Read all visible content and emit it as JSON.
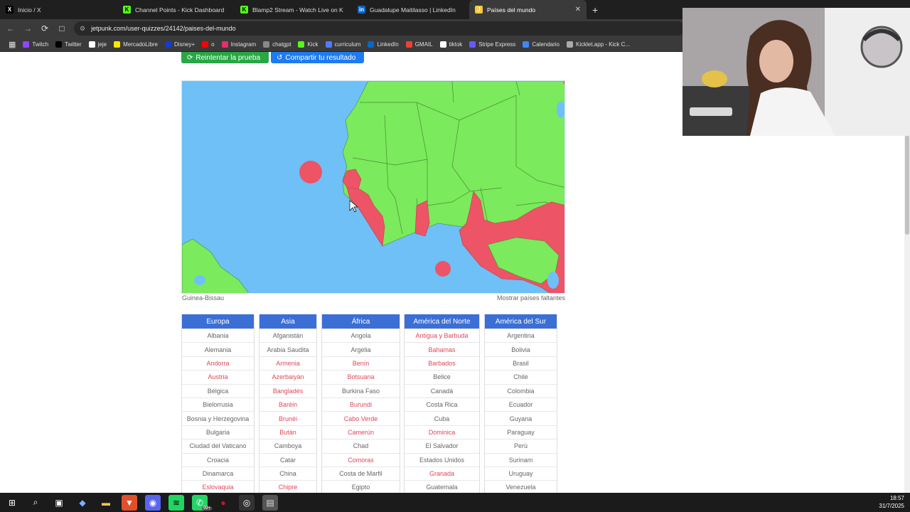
{
  "browser": {
    "tabs": [
      {
        "title": "Inicio / X",
        "icon": "x-icon",
        "active": false
      },
      {
        "title": "Channel Points - Kick Dashboard",
        "icon": "kick-icon",
        "active": false
      },
      {
        "title": "Blamp2 Stream - Watch Live on K",
        "icon": "kick-icon",
        "active": false
      },
      {
        "title": "Guadalupe Maitilasso | LinkedIn",
        "icon": "linkedin-icon",
        "active": false
      },
      {
        "title": "Países del mundo",
        "icon": "jetpunk-icon",
        "active": true
      }
    ],
    "new_tab": "+",
    "close_tab": "✕",
    "url": "jetpunk.com/user-quizzes/24142/paises-del-mundo",
    "bookmarks": [
      {
        "label": "Twitch",
        "icon": "twitch-icon",
        "color": "#9146ff"
      },
      {
        "label": "Twitter",
        "icon": "x-icon",
        "color": "#000000"
      },
      {
        "label": "jeje",
        "icon": "github-icon",
        "color": "#ffffff"
      },
      {
        "label": "MercadoLibre",
        "icon": "mercadolibre-icon",
        "color": "#ffe600"
      },
      {
        "label": "Disney+",
        "icon": "disney-icon",
        "color": "#113ccf"
      },
      {
        "label": "o",
        "icon": "youtube-icon",
        "color": "#ff0000"
      },
      {
        "label": "Instagram",
        "icon": "instagram-icon",
        "color": "#e1306c"
      },
      {
        "label": "chatgpt",
        "icon": "chatgpt-icon",
        "color": "#888888"
      },
      {
        "label": "Kick",
        "icon": "kick-icon",
        "color": "#53fc18"
      },
      {
        "label": "curriculum",
        "icon": "docs-icon",
        "color": "#4f7bff"
      },
      {
        "label": "LinkedIn",
        "icon": "linkedin-icon",
        "color": "#0a66c2"
      },
      {
        "label": "GMAIL",
        "icon": "gmail-icon",
        "color": "#ea4335"
      },
      {
        "label": "tiktok",
        "icon": "tiktok-icon",
        "color": "#ffffff"
      },
      {
        "label": "Stripe Express",
        "icon": "stripe-icon",
        "color": "#635bff"
      },
      {
        "label": "Calendario",
        "icon": "calendar-icon",
        "color": "#4285f4"
      },
      {
        "label": "Kicklet.app - Kick C...",
        "icon": "kicklet-icon",
        "color": "#aaaaaa"
      }
    ]
  },
  "quiz": {
    "retry_label": "Reintentar la prueba",
    "share_label": "Compartir tu resultado",
    "hover_country": "Guinea-Bissau",
    "show_missing": "Mostrar países faltantes",
    "colors": {
      "found": "#7bea5c",
      "missing": "#ed5466",
      "ocean": "#6ec0f7",
      "header": "#3b6fd6"
    },
    "columns": [
      {
        "title": "Europa",
        "items": [
          {
            "name": "Albania",
            "missing": false
          },
          {
            "name": "Alemania",
            "missing": false
          },
          {
            "name": "Andorra",
            "missing": true
          },
          {
            "name": "Austria",
            "missing": true
          },
          {
            "name": "Bélgica",
            "missing": false
          },
          {
            "name": "Bielorrusia",
            "missing": false
          },
          {
            "name": "Bosnia y Herzegovina",
            "missing": false
          },
          {
            "name": "Bulgaria",
            "missing": false
          },
          {
            "name": "Ciudad del Vaticano",
            "missing": false
          },
          {
            "name": "Croacia",
            "missing": false
          },
          {
            "name": "Dinamarca",
            "missing": false
          },
          {
            "name": "Eslovaquia",
            "missing": true
          }
        ]
      },
      {
        "title": "Asia",
        "items": [
          {
            "name": "Afganistán",
            "missing": false
          },
          {
            "name": "Arabia Saudita",
            "missing": false
          },
          {
            "name": "Armenia",
            "missing": true
          },
          {
            "name": "Azerbaiyán",
            "missing": true
          },
          {
            "name": "Bangladés",
            "missing": true
          },
          {
            "name": "Baréin",
            "missing": true
          },
          {
            "name": "Brunéi",
            "missing": true
          },
          {
            "name": "Bután",
            "missing": true
          },
          {
            "name": "Camboya",
            "missing": false
          },
          {
            "name": "Catar",
            "missing": false
          },
          {
            "name": "China",
            "missing": false
          },
          {
            "name": "Chipre",
            "missing": true
          }
        ]
      },
      {
        "title": "África",
        "items": [
          {
            "name": "Angola",
            "missing": false
          },
          {
            "name": "Argelia",
            "missing": false
          },
          {
            "name": "Benín",
            "missing": true
          },
          {
            "name": "Botsuana",
            "missing": true
          },
          {
            "name": "Burkina Faso",
            "missing": false
          },
          {
            "name": "Burundi",
            "missing": true
          },
          {
            "name": "Cabo Verde",
            "missing": true
          },
          {
            "name": "Camerún",
            "missing": true
          },
          {
            "name": "Chad",
            "missing": false
          },
          {
            "name": "Comoras",
            "missing": true
          },
          {
            "name": "Costa de Marfil",
            "missing": false
          },
          {
            "name": "Egipto",
            "missing": false
          }
        ]
      },
      {
        "title": "América del Norte",
        "items": [
          {
            "name": "Antigua y Barbuda",
            "missing": true
          },
          {
            "name": "Bahamas",
            "missing": true
          },
          {
            "name": "Barbados",
            "missing": true
          },
          {
            "name": "Belice",
            "missing": false
          },
          {
            "name": "Canadá",
            "missing": false
          },
          {
            "name": "Costa Rica",
            "missing": false
          },
          {
            "name": "Cuba",
            "missing": false
          },
          {
            "name": "Dominica",
            "missing": true
          },
          {
            "name": "El Salvador",
            "missing": false
          },
          {
            "name": "Estados Unidos",
            "missing": false
          },
          {
            "name": "Granada",
            "missing": true
          },
          {
            "name": "Guatemala",
            "missing": false
          }
        ]
      },
      {
        "title": "América del Sur",
        "items": [
          {
            "name": "Argentina",
            "missing": false
          },
          {
            "name": "Bolivia",
            "missing": false
          },
          {
            "name": "Brasil",
            "missing": false
          },
          {
            "name": "Chile",
            "missing": false
          },
          {
            "name": "Colombia",
            "missing": false
          },
          {
            "name": "Ecuador",
            "missing": false
          },
          {
            "name": "Guyana",
            "missing": false
          },
          {
            "name": "Paraguay",
            "missing": false
          },
          {
            "name": "Perú",
            "missing": false
          },
          {
            "name": "Surinam",
            "missing": false
          },
          {
            "name": "Uruguay",
            "missing": false
          },
          {
            "name": "Venezuela",
            "missing": false
          }
        ]
      }
    ]
  },
  "taskbar": {
    "apps": [
      "windows-start-icon",
      "search-icon",
      "task-view-icon",
      "copilot-icon",
      "file-explorer-icon",
      "brave-icon",
      "discord-icon",
      "spotify-icon",
      "whatsapp-icon",
      "app-icon",
      "obs-icon",
      "notes-icon"
    ],
    "whatsapp_badge": "99+",
    "time": "18:57",
    "date": "31/7/2025"
  }
}
